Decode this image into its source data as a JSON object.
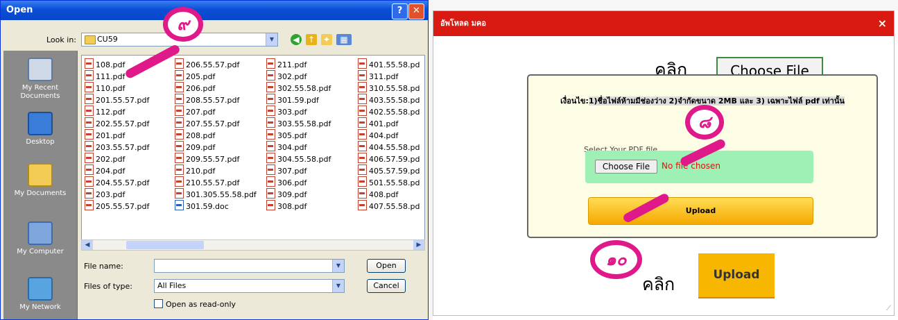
{
  "dialog": {
    "title": "Open",
    "help_glyph": "?",
    "close_glyph": "✕",
    "look_in_label": "Look in:",
    "look_in_value": "CU59",
    "places": [
      "My Recent Documents",
      "Desktop",
      "My Documents",
      "My Computer",
      "My Network"
    ],
    "files": [
      [
        "108.pdf",
        "111.pdf",
        "110.pdf",
        "201.55.57.pdf",
        "112.pdf",
        "202.55.57.pdf",
        "201.pdf",
        "203.55.57.pdf",
        "202.pdf",
        "204.pdf",
        "204.55.57.pdf",
        "203.pdf",
        "205.55.57.pdf"
      ],
      [
        "206.55.57.pdf",
        "205.pdf",
        "206.pdf",
        "208.55.57.pdf",
        "207.pdf",
        "207.55.57.pdf",
        "208.pdf",
        "209.pdf",
        "209.55.57.pdf",
        "210.pdf",
        "210.55.57.pdf",
        "301.305.55.58.pdf",
        "301.59.doc"
      ],
      [
        "211.pdf",
        "302.pdf",
        "302.55.58.pdf",
        "301.59.pdf",
        "303.pdf",
        "303.55.58.pdf",
        "305.pdf",
        "304.pdf",
        "304.55.58.pdf",
        "307.pdf",
        "306.pdf",
        "309.pdf",
        "308.pdf"
      ],
      [
        "401.55.58.pd",
        "311.pdf",
        "310.55.58.pd",
        "403.55.58.pd",
        "402.55.58.pd",
        "401.pdf",
        "404.pdf",
        "404.55.58.pd",
        "406.57.59.pd",
        "405.57.59.pd",
        "501.55.58.pd",
        "408.pdf",
        "407.55.58.pd"
      ]
    ],
    "file_name_label": "File name:",
    "file_name_value": "",
    "files_of_type_label": "Files of type:",
    "files_of_type_value": "All Files",
    "open_button": "Open",
    "cancel_button": "Cancel",
    "readonly_label": "Open as read-only"
  },
  "modal": {
    "title": "อัพโหลด มคอ",
    "close_glyph": "×",
    "instruction_click": "คลิก",
    "choose_file_large": "Choose File",
    "condition_prefix": "เงื่อนไข:",
    "condition_text": "1)ชื่อไฟล์ห้ามมีช่องว่าง 2)จำกัดขนาด 2MB และ 3) เฉพาะไฟล์ pdf เท่านั้น",
    "select_label": "Select Your PDF file",
    "choose_file_button": "Choose File",
    "no_file_text": "No file chosen",
    "upload_button": "Upload",
    "instruction_click_2": "คลิก",
    "upload_large": "Upload"
  },
  "annotations": {
    "step_9": "๙",
    "step_8": "๘",
    "step_10": "๑๐"
  },
  "colors": {
    "xp_title": "#0a4fd6",
    "modal_header": "#d91a12",
    "callout": "#e0198a",
    "upload": "#f7b700",
    "file_area": "#9ff0b4"
  }
}
